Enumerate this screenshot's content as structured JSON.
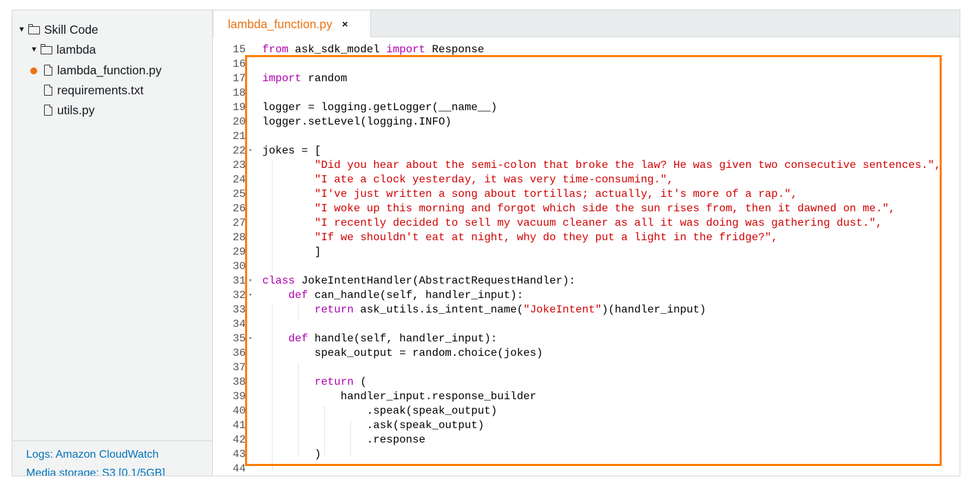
{
  "sidebar": {
    "tree": [
      {
        "label": "Skill Code",
        "type": "folder",
        "expanded": true
      },
      {
        "label": "lambda",
        "type": "folder",
        "expanded": true
      },
      {
        "label": "lambda_function.py",
        "type": "file",
        "modified": true
      },
      {
        "label": "requirements.txt",
        "type": "file",
        "modified": false
      },
      {
        "label": "utils.py",
        "type": "file",
        "modified": false
      }
    ],
    "footer": {
      "logs_link": "Logs: Amazon CloudWatch",
      "media_link": "Media storage: S3 [0.1/5GB]"
    }
  },
  "tabs": [
    {
      "label": "lambda_function.py",
      "close": "×",
      "active": true
    }
  ],
  "editor": {
    "lines": [
      {
        "n": "15",
        "parts": [
          {
            "t": "from",
            "c": "kw"
          },
          {
            "t": " ask_sdk_model "
          },
          {
            "t": "import",
            "c": "kw"
          },
          {
            "t": " Response"
          }
        ]
      },
      {
        "n": "16",
        "parts": []
      },
      {
        "n": "17",
        "parts": [
          {
            "t": "import",
            "c": "kw"
          },
          {
            "t": " random"
          }
        ]
      },
      {
        "n": "18",
        "parts": []
      },
      {
        "n": "19",
        "parts": [
          {
            "t": "logger = logging.getLogger(__name__)"
          }
        ]
      },
      {
        "n": "20",
        "parts": [
          {
            "t": "logger.setLevel(logging.INFO)"
          }
        ]
      },
      {
        "n": "21",
        "parts": []
      },
      {
        "n": "22",
        "fold": true,
        "parts": [
          {
            "t": "jokes = ["
          }
        ]
      },
      {
        "n": "23",
        "parts": [
          {
            "t": "        "
          },
          {
            "t": "\"Did you hear about the semi-colon that broke the law? He was given two consecutive sentences.\",",
            "c": "str"
          }
        ]
      },
      {
        "n": "24",
        "parts": [
          {
            "t": "        "
          },
          {
            "t": "\"I ate a clock yesterday, it was very time-consuming.\",",
            "c": "str"
          }
        ]
      },
      {
        "n": "25",
        "parts": [
          {
            "t": "        "
          },
          {
            "t": "\"I've just written a song about tortillas; actually, it's more of a rap.\",",
            "c": "str"
          }
        ]
      },
      {
        "n": "26",
        "parts": [
          {
            "t": "        "
          },
          {
            "t": "\"I woke up this morning and forgot which side the sun rises from, then it dawned on me.\",",
            "c": "str"
          }
        ]
      },
      {
        "n": "27",
        "parts": [
          {
            "t": "        "
          },
          {
            "t": "\"I recently decided to sell my vacuum cleaner as all it was doing was gathering dust.\",",
            "c": "str"
          }
        ]
      },
      {
        "n": "28",
        "parts": [
          {
            "t": "        "
          },
          {
            "t": "\"If we shouldn't eat at night, why do they put a light in the fridge?\",",
            "c": "str"
          }
        ]
      },
      {
        "n": "29",
        "parts": [
          {
            "t": "        ]"
          }
        ]
      },
      {
        "n": "30",
        "parts": []
      },
      {
        "n": "31",
        "fold": true,
        "parts": [
          {
            "t": "class",
            "c": "kw"
          },
          {
            "t": " JokeIntentHandler(AbstractRequestHandler):"
          }
        ]
      },
      {
        "n": "32",
        "fold": true,
        "parts": [
          {
            "t": "    "
          },
          {
            "t": "def",
            "c": "kw"
          },
          {
            "t": " can_handle(self, handler_input):"
          }
        ]
      },
      {
        "n": "33",
        "parts": [
          {
            "t": "        "
          },
          {
            "t": "return",
            "c": "kw"
          },
          {
            "t": " ask_utils.is_intent_name("
          },
          {
            "t": "\"JokeIntent\"",
            "c": "str"
          },
          {
            "t": ")(handler_input)"
          }
        ]
      },
      {
        "n": "34",
        "parts": []
      },
      {
        "n": "35",
        "fold": true,
        "parts": [
          {
            "t": "    "
          },
          {
            "t": "def",
            "c": "kw"
          },
          {
            "t": " handle(self, handler_input):"
          }
        ]
      },
      {
        "n": "36",
        "parts": [
          {
            "t": "        speak_output = random.choice(jokes)"
          }
        ]
      },
      {
        "n": "37",
        "parts": []
      },
      {
        "n": "38",
        "parts": [
          {
            "t": "        "
          },
          {
            "t": "return",
            "c": "kw"
          },
          {
            "t": " ("
          }
        ]
      },
      {
        "n": "39",
        "parts": [
          {
            "t": "            handler_input.response_builder"
          }
        ]
      },
      {
        "n": "40",
        "parts": [
          {
            "t": "                .speak(speak_output)"
          }
        ]
      },
      {
        "n": "41",
        "parts": [
          {
            "t": "                .ask(speak_output)"
          }
        ]
      },
      {
        "n": "42",
        "parts": [
          {
            "t": "                .response"
          }
        ]
      },
      {
        "n": "43",
        "parts": [
          {
            "t": "        )"
          }
        ]
      },
      {
        "n": "44",
        "parts": []
      }
    ]
  },
  "colors": {
    "accent": "#ec7211",
    "highlight_border": "#ff7c00",
    "keyword": "#b000b0",
    "string": "#d10000",
    "link": "#0073bb"
  }
}
